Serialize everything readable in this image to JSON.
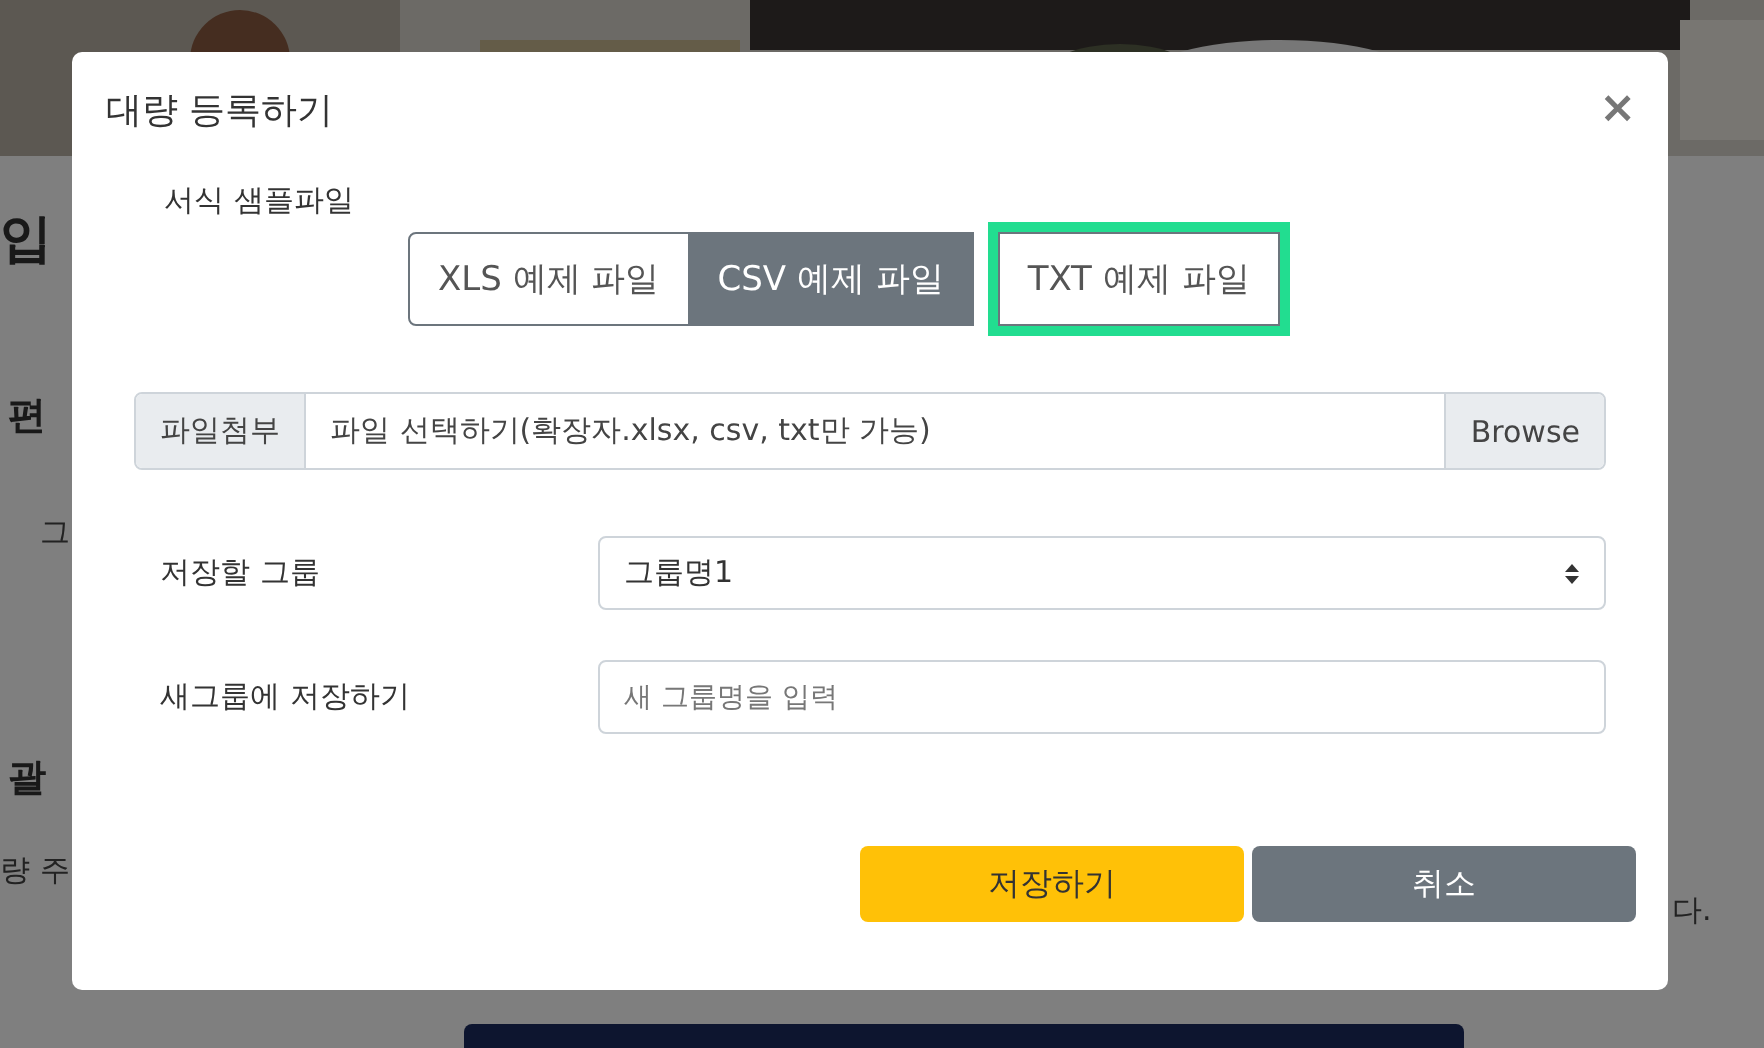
{
  "background": {
    "heading": "입",
    "sections": [
      {
        "title": "편",
        "line": "그"
      },
      {
        "title": "괄",
        "line": "량 주"
      }
    ],
    "line_end": "다."
  },
  "modal": {
    "title": "대량 등록하기",
    "close": "×",
    "sample_label": "서식 샘플파일",
    "samples": [
      {
        "label": "XLS 예제 파일",
        "selected": false,
        "highlighted": false
      },
      {
        "label": "CSV 예제 파일",
        "selected": true,
        "highlighted": false
      },
      {
        "label": "TXT 예제 파일",
        "selected": false,
        "highlighted": true
      }
    ],
    "file": {
      "addon": "파일첨부",
      "placeholder": "파일 선택하기(확장자.xlsx, csv, txt만 가능)",
      "browse": "Browse"
    },
    "fields": [
      {
        "kind": "select",
        "label": "저장할 그룹",
        "value": "그룹명1"
      },
      {
        "kind": "input",
        "label": "새그룹에 저장하기",
        "placeholder": "새 그룹명을 입력"
      }
    ],
    "buttons": [
      {
        "label": "저장하기",
        "kind": "primary"
      },
      {
        "label": "취소",
        "kind": "secondary"
      }
    ]
  }
}
